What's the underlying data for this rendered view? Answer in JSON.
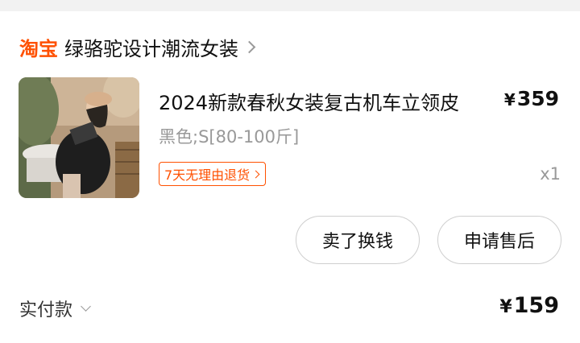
{
  "shop": {
    "logo_text": "淘宝",
    "name": "绿骆驼设计潮流女装"
  },
  "product": {
    "title": "2024新款春秋女装复古机车立领皮",
    "price_symbol": "¥",
    "price": "359",
    "variant": "黑色;S[80-100斤]",
    "return_policy": "7天无理由退货",
    "quantity": "x1",
    "image_icon": "product-photo"
  },
  "actions": {
    "sell_label": "卖了换钱",
    "after_sales_label": "申请售后"
  },
  "payment": {
    "label": "实付款",
    "amount_symbol": "¥",
    "amount": "159"
  },
  "colors": {
    "brand": "#ff5000",
    "text": "#111111",
    "muted": "#999999",
    "border": "#cfcfcf"
  }
}
